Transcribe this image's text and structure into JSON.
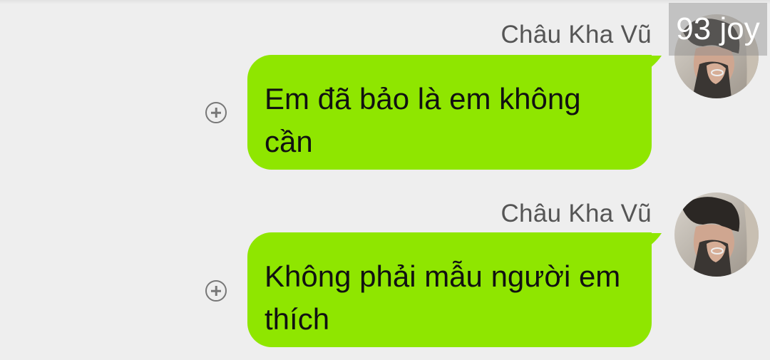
{
  "watermark": {
    "text": "93 joy"
  },
  "messages": [
    {
      "sender": "Châu Kha Vũ",
      "text": "Em đã bảo là em không cần"
    },
    {
      "sender": "Châu Kha Vũ",
      "text": "Không phải mẫu người em thích"
    }
  ],
  "icons": {
    "add_reaction": "plus-circle-icon",
    "avatar": "profile-photo"
  },
  "colors": {
    "background": "#eeeeee",
    "bubble": "#8fe600",
    "sender_name": "#555555",
    "message_text": "#111111",
    "icon": "#777777"
  }
}
